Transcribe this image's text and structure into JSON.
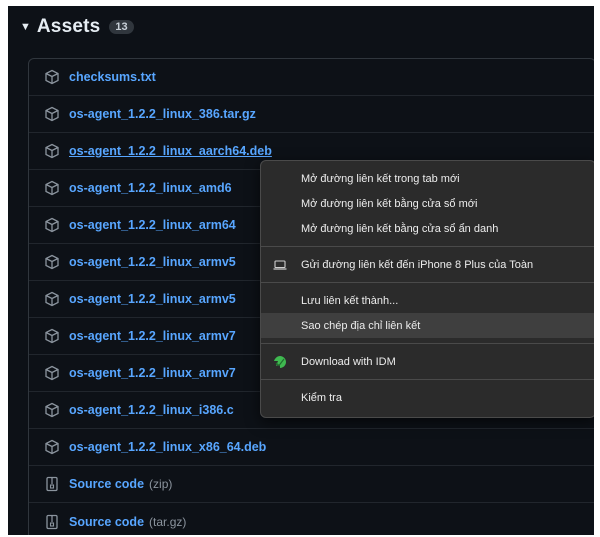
{
  "assets": {
    "title": "Assets",
    "count": "13",
    "items": [
      {
        "name": "checksums.txt",
        "suffix": "",
        "icon": "package-icon"
      },
      {
        "name": "os-agent_1.2.2_linux_386.tar.gz",
        "suffix": "",
        "icon": "package-icon"
      },
      {
        "name": "os-agent_1.2.2_linux_aarch64.deb",
        "suffix": "",
        "icon": "package-icon"
      },
      {
        "name": "os-agent_1.2.2_linux_amd6",
        "suffix": "",
        "icon": "package-icon"
      },
      {
        "name": "os-agent_1.2.2_linux_arm64",
        "suffix": "",
        "icon": "package-icon"
      },
      {
        "name": "os-agent_1.2.2_linux_armv5",
        "suffix": "",
        "icon": "package-icon"
      },
      {
        "name": "os-agent_1.2.2_linux_armv5",
        "suffix": "",
        "icon": "package-icon"
      },
      {
        "name": "os-agent_1.2.2_linux_armv7",
        "suffix": "",
        "icon": "package-icon"
      },
      {
        "name": "os-agent_1.2.2_linux_armv7",
        "suffix": "",
        "icon": "package-icon"
      },
      {
        "name": "os-agent_1.2.2_linux_i386.c",
        "suffix": "",
        "icon": "package-icon"
      },
      {
        "name": "os-agent_1.2.2_linux_x86_64.deb",
        "suffix": "",
        "icon": "package-icon"
      },
      {
        "name": "Source code",
        "suffix": "(zip)",
        "icon": "file-zip-icon"
      },
      {
        "name": "Source code",
        "suffix": "(tar.gz)",
        "icon": "file-zip-icon"
      }
    ]
  },
  "context_menu": {
    "items": [
      {
        "label": "Mở đường liên kết trong tab mới"
      },
      {
        "label": "Mở đường liên kết bằng cửa sổ mới"
      },
      {
        "label": "Mở đường liên kết bằng cửa sổ ẩn danh"
      },
      {
        "label": "Gửi đường liên kết đến iPhone 8 Plus của Toàn"
      },
      {
        "label": "Lưu liên kết thành..."
      },
      {
        "label": "Sao chép địa chỉ liên kết"
      },
      {
        "label": "Download with IDM"
      },
      {
        "label": "Kiểm tra"
      }
    ]
  },
  "colors": {
    "background": "#0d1117",
    "link": "#58a6ff",
    "menu_background": "#2b2b2b",
    "menu_highlight": "#3f3f3f"
  }
}
